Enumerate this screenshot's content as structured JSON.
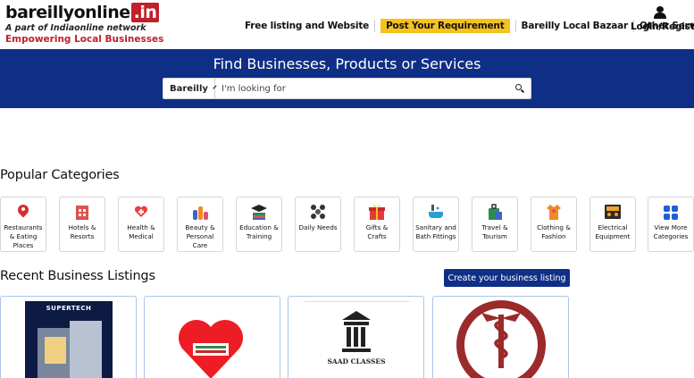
{
  "header": {
    "logo": {
      "name": "bareillyonline",
      "tld": ".in",
      "tagline": "A part of Indiaonline network",
      "slogan": "Empowering Local Businesses"
    },
    "nav": [
      {
        "label": "Free listing and Website"
      },
      {
        "label": "Post Your Requirement",
        "highlight": "#f7c21e"
      },
      {
        "label": "Bareilly Local Bazaar"
      },
      {
        "label": "Other Services",
        "icon": "chevron-down-icon"
      }
    ],
    "login": {
      "label": "Login/Register",
      "icon": "user-icon"
    }
  },
  "hero": {
    "title": "Find Businesses, Products or Services",
    "city": "Bareilly",
    "search_placeholder": "I'm looking for",
    "background": "#0f2f86"
  },
  "popular": {
    "title": "Popular Categories",
    "items": [
      {
        "label": "Restaurants & Eating Places",
        "icon": "location-pin-icon"
      },
      {
        "label": "Hotels & Resorts",
        "icon": "hotel-icon"
      },
      {
        "label": "Health & Medical",
        "icon": "health-heart-icon"
      },
      {
        "label": "Beauty & Personal Care",
        "icon": "beauty-icon"
      },
      {
        "label": "Education & Training",
        "icon": "graduation-icon"
      },
      {
        "label": "Daily Needs",
        "icon": "daily-needs-icon"
      },
      {
        "label": "Gifts & Crafts",
        "icon": "gift-icon"
      },
      {
        "label": "Sanitary and Bath Fittings",
        "icon": "bath-icon"
      },
      {
        "label": "Travel & Tourism",
        "icon": "travel-icon"
      },
      {
        "label": "Clothing & Fashion",
        "icon": "clothing-icon"
      },
      {
        "label": "Electrical Equipment",
        "icon": "electrical-icon"
      },
      {
        "label": "View More Categories",
        "icon": "grid-icon"
      }
    ]
  },
  "recent": {
    "title": "Recent Business Listings",
    "create_label": "Create your business listing",
    "listings": [
      {
        "image_text": "SUPERTECH",
        "icon": "building-logo-icon"
      },
      {
        "image_text": "",
        "icon": "red-heart-logo-icon"
      },
      {
        "image_text": "SAAD CLASSES",
        "icon": "saad-classes-logo-icon"
      },
      {
        "image_text": "",
        "icon": "medical-trust-emblem-icon"
      }
    ]
  },
  "colors": {
    "brand_blue": "#0f2f86",
    "accent_yellow": "#f7c21e",
    "brand_red": "#c0202b"
  }
}
